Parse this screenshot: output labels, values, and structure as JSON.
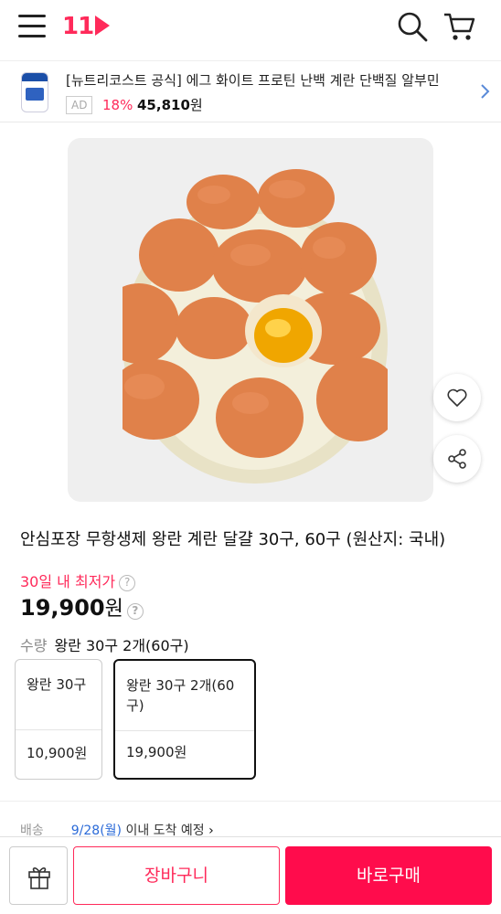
{
  "header": {
    "logo_text": "11",
    "icons": [
      "menu-icon",
      "search-icon",
      "cart-icon"
    ]
  },
  "ad": {
    "title": "[뉴트리코스트 공식] 에그 화이트 프로틴 난백 계란 단백질 알부민",
    "badge": "AD",
    "discount": "18%",
    "price": "45,810",
    "currency": "원"
  },
  "product": {
    "title": "안심포장 무항생제 왕란 계란 달걀 30구, 60구 (원산지: 국내)",
    "lowest_label": "30일 내 최저가",
    "price": "19,900",
    "currency": "원"
  },
  "options": {
    "label": "수량",
    "selected_text": "왕란 30구 2개(60구)",
    "items": [
      {
        "name": "왕란 30구",
        "price": "10,900원",
        "selected": false
      },
      {
        "name": "왕란 30구 2개(60구)",
        "price": "19,900원",
        "selected": true
      }
    ]
  },
  "delivery": {
    "label": "배송",
    "date": "9/28(월)",
    "rest": "이내 도착 예정"
  },
  "bottom_bar": {
    "cart_label": "장바구니",
    "buy_label": "바로구매"
  },
  "colors": {
    "brand": "#ff2a5a",
    "buy_button": "#ff0c4c",
    "link": "#2a6ad8"
  }
}
